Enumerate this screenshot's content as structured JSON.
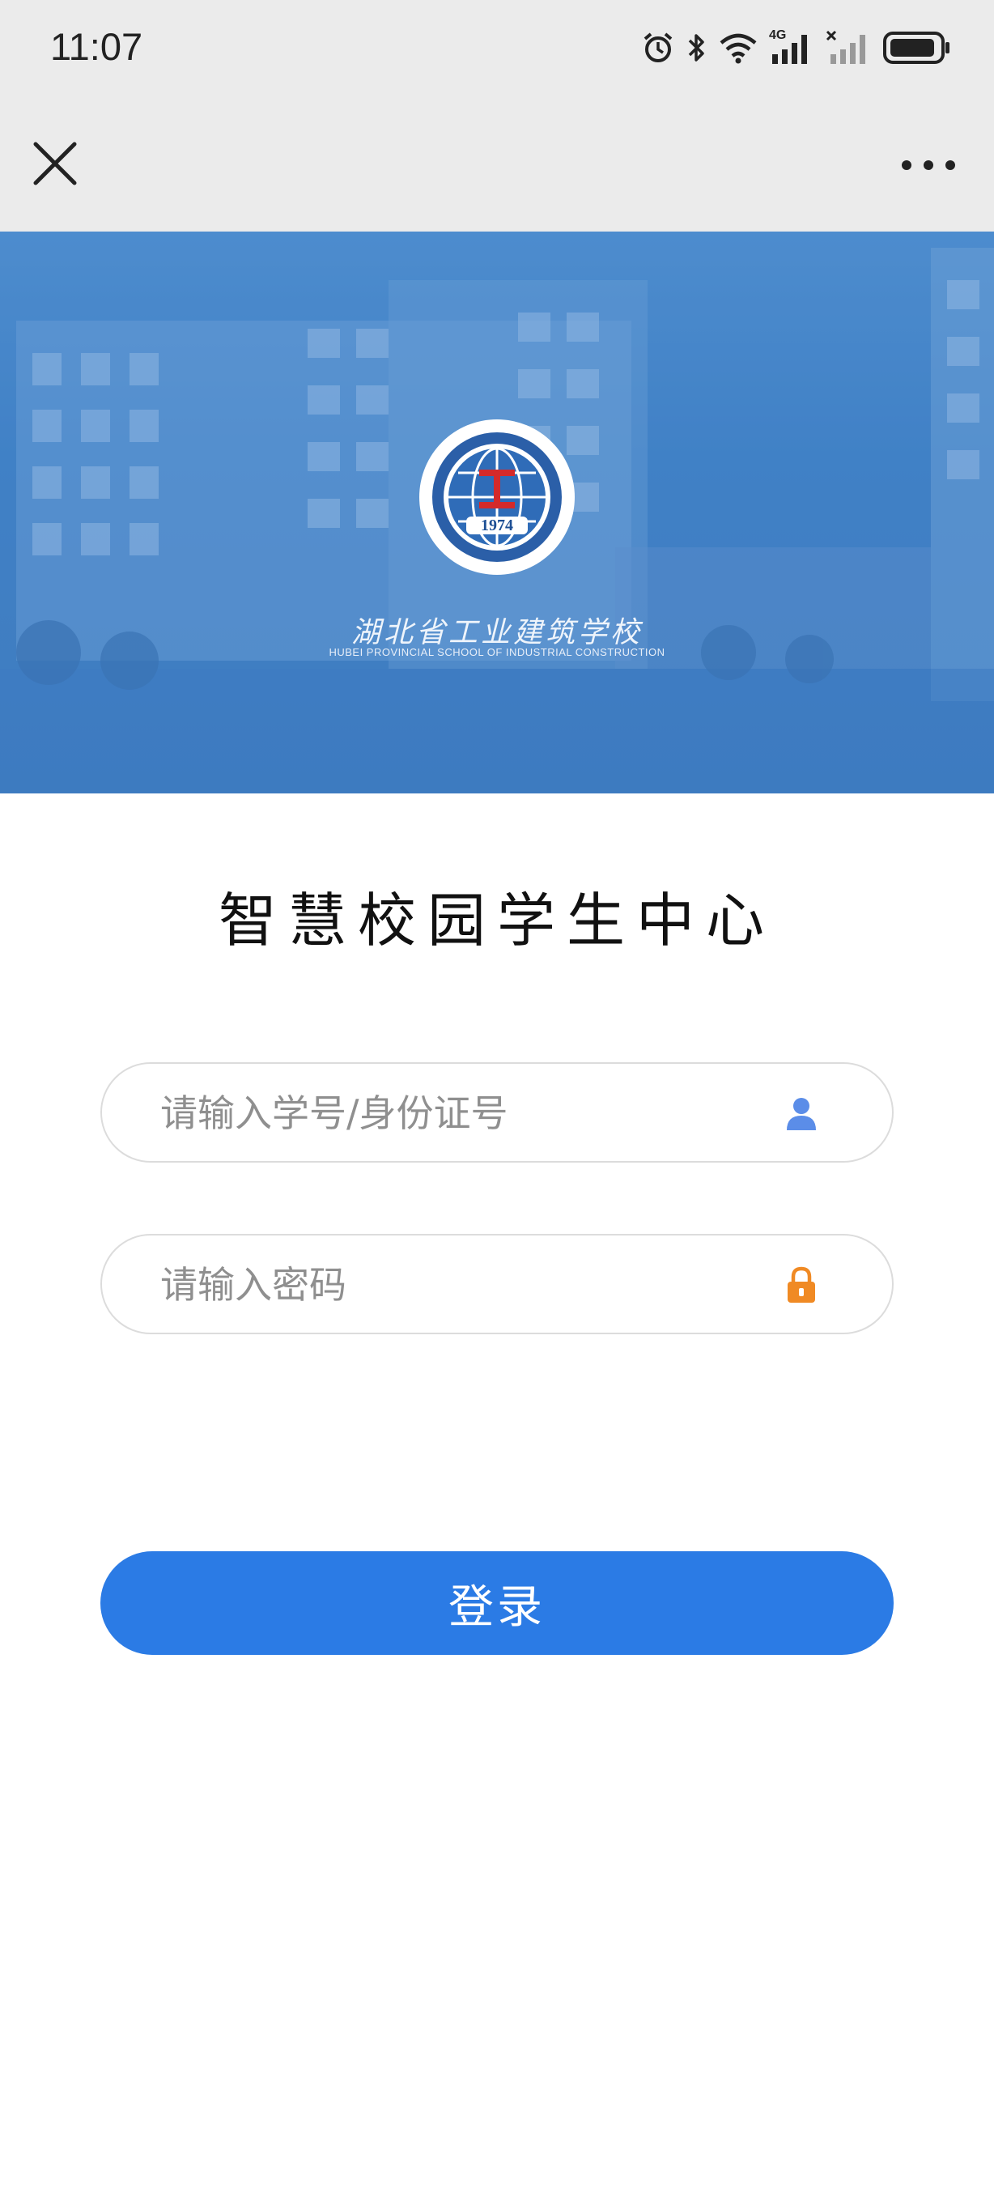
{
  "status_bar": {
    "time": "11:07",
    "icons": [
      "alarm-icon",
      "bluetooth-icon",
      "wifi-icon",
      "signal-4g-icon",
      "signal-no-service-icon",
      "battery-icon"
    ],
    "network_label": "4G"
  },
  "nav": {
    "close_icon": "close-icon",
    "more_icon": "more-icon"
  },
  "banner": {
    "logo_year": "1974",
    "school_name_cn": "湖北省工业建筑学校",
    "school_name_en": "HUBEI PROVINCIAL SCHOOL OF INDUSTRIAL CONSTRUCTION",
    "accent_color": "#3d7fc6"
  },
  "login": {
    "title": "智慧校园学生中心",
    "username_placeholder": "请输入学号/身份证号",
    "username_value": "",
    "password_placeholder": "请输入密码",
    "password_value": "",
    "submit_label": "登录",
    "button_color": "#2b7be5",
    "user_icon_color": "#5b8de8",
    "lock_icon_color": "#f08a24"
  }
}
